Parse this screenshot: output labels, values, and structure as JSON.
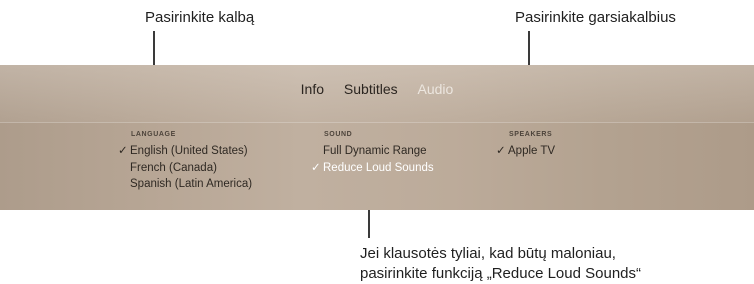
{
  "callouts": {
    "language": "Pasirinkite kalbą",
    "speakers": "Pasirinkite garsiakalbius",
    "reduce_line1": "Jei klausotės tyliai, kad būtų maloniau,",
    "reduce_line2": "pasirinkite funkciją „Reduce Loud Sounds“"
  },
  "tabs": [
    {
      "label": "Info",
      "state": "normal"
    },
    {
      "label": "Subtitles",
      "state": "normal"
    },
    {
      "label": "Audio",
      "state": "selected"
    }
  ],
  "columns": {
    "language": {
      "header": "LANGUAGE",
      "options": [
        {
          "label": "English (United States)",
          "checked": true
        },
        {
          "label": "French (Canada)",
          "checked": false
        },
        {
          "label": "Spanish (Latin America)",
          "checked": false
        }
      ]
    },
    "sound": {
      "header": "SOUND",
      "options": [
        {
          "label": "Full Dynamic Range",
          "checked": false
        },
        {
          "label": "Reduce Loud Sounds",
          "checked": true,
          "focused": true
        }
      ]
    },
    "speakers": {
      "header": "SPEAKERS",
      "options": [
        {
          "label": "Apple TV",
          "checked": true
        }
      ]
    }
  },
  "check_glyph": "✓",
  "colors": {
    "panel": "#b8a795",
    "selected_tab": "#ece6df",
    "focused_text": "#ffffff"
  }
}
